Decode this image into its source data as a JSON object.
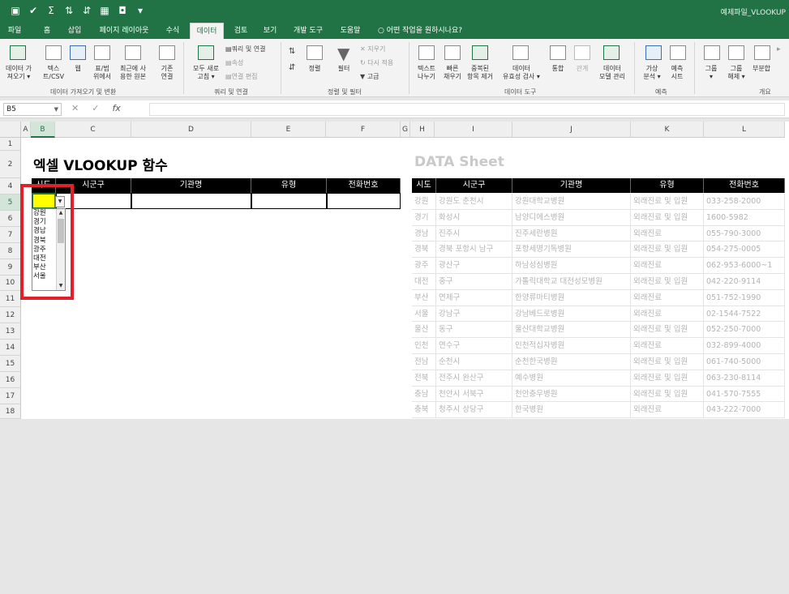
{
  "window": {
    "title": "예제파일_VLOOKUP"
  },
  "tabs": [
    {
      "label": "파일",
      "active": false
    },
    {
      "label": "홈",
      "active": false
    },
    {
      "label": "삽입",
      "active": false
    },
    {
      "label": "페이지 레이아웃",
      "active": false
    },
    {
      "label": "수식",
      "active": false
    },
    {
      "label": "데이터",
      "active": true
    },
    {
      "label": "검토",
      "active": false
    },
    {
      "label": "보기",
      "active": false
    },
    {
      "label": "개발 도구",
      "active": false
    },
    {
      "label": "도움말",
      "active": false
    }
  ],
  "tell_me": "어떤 작업을 원하시나요?",
  "ribbon": {
    "get_data": "데이터 가\n져오기 ▾",
    "text_csv": "텍스\n트/CSV",
    "web": "웹",
    "table_range": "표/범\n위에서",
    "recent_sources": "최근에 사\n용한 원본",
    "existing_conn": "기존\n연결",
    "refresh_all": "모두 새로\n고침 ▾",
    "queries_conn": "쿼리 및 연결",
    "properties": "속성",
    "edit_links": "연결 편집",
    "sort": "정렬",
    "filter": "필터",
    "clear": "지우기",
    "reapply": "다시 적용",
    "advanced": "고급",
    "text_to_cols": "텍스트\n나누기",
    "flash_fill": "빠른\n채우기",
    "remove_dup": "중복된\n항목 제거",
    "data_validation": "데이터\n유효성 검사 ▾",
    "consolidate": "통합",
    "relationships": "관계",
    "data_model": "데이터\n모델 관리",
    "what_if": "가상\n분석 ▾",
    "forecast_sheet": "예측\n시트",
    "group": "그룹\n▾",
    "ungroup": "그룹\n해제 ▾",
    "subtotal": "부분합",
    "groups": {
      "get_transform": "데이터 가져오기 및 변환",
      "queries": "쿼리 및 연결",
      "sort_filter": "정렬 및 필터",
      "data_tools": "데이터 도구",
      "forecast": "예측",
      "outline": "개요"
    }
  },
  "formula_bar": {
    "name_box": "B5",
    "formula": ""
  },
  "columns": [
    "A",
    "B",
    "C",
    "D",
    "E",
    "F",
    "G",
    "H",
    "I",
    "J",
    "K",
    "L"
  ],
  "rows": [
    "1",
    "2",
    "4",
    "5",
    "6",
    "7",
    "8",
    "9",
    "10",
    "11",
    "12",
    "13",
    "14",
    "15",
    "16",
    "17",
    "18"
  ],
  "left": {
    "title": "엑셀 VLOOKUP 함수",
    "headers": [
      "시도",
      "시군구",
      "기관명",
      "유형",
      "전화번호"
    ]
  },
  "dropdown": {
    "options": [
      "강원",
      "경기",
      "경남",
      "경북",
      "광주",
      "대전",
      "부산",
      "서울"
    ]
  },
  "right": {
    "title": "DATA Sheet",
    "headers": [
      "시도",
      "시군구",
      "기관명",
      "유형",
      "전화번호"
    ],
    "rows": [
      [
        "강원",
        "강원도 춘천시",
        "강원대학교병원",
        "외래진료 및 입원",
        "033-258-2000"
      ],
      [
        "경기",
        "화성시",
        "남양디에스병원",
        "외래진료 및 입원",
        "1600-5982"
      ],
      [
        "경남",
        "진주시",
        "진주세란병원",
        "외래진료",
        "055-790-3000"
      ],
      [
        "경북",
        "경북 포항시 남구",
        "포항세명기독병원",
        "외래진료 및 입원",
        "054-275-0005"
      ],
      [
        "광주",
        "광산구",
        "하남성심병원",
        "외래진료",
        "062-953-6000~1"
      ],
      [
        "대전",
        "중구",
        "가톨릭대학교 대전성모병원",
        "외래진료 및 입원",
        "042-220-9114"
      ],
      [
        "부산",
        "연제구",
        "한양류마티병원",
        "외래진료",
        "051-752-1990"
      ],
      [
        "서울",
        "강남구",
        "강남베드로병원",
        "외래진료",
        "02-1544-7522"
      ],
      [
        "울산",
        "동구",
        "울산대학교병원",
        "외래진료 및 입원",
        "052-250-7000"
      ],
      [
        "인천",
        "연수구",
        "인천적십자병원",
        "외래진료",
        "032-899-4000"
      ],
      [
        "전남",
        "순천시",
        "순천한국병원",
        "외래진료 및 입원",
        "061-740-5000"
      ],
      [
        "전북",
        "전주시 완산구",
        "예수병원",
        "외래진료 및 입원",
        "063-230-8114"
      ],
      [
        "충남",
        "천안시 서북구",
        "천안충무병원",
        "외래진료 및 입원",
        "041-570-7555"
      ],
      [
        "충북",
        "청주시 상당구",
        "한국병원",
        "외래진료",
        "043-222-7000"
      ]
    ]
  }
}
